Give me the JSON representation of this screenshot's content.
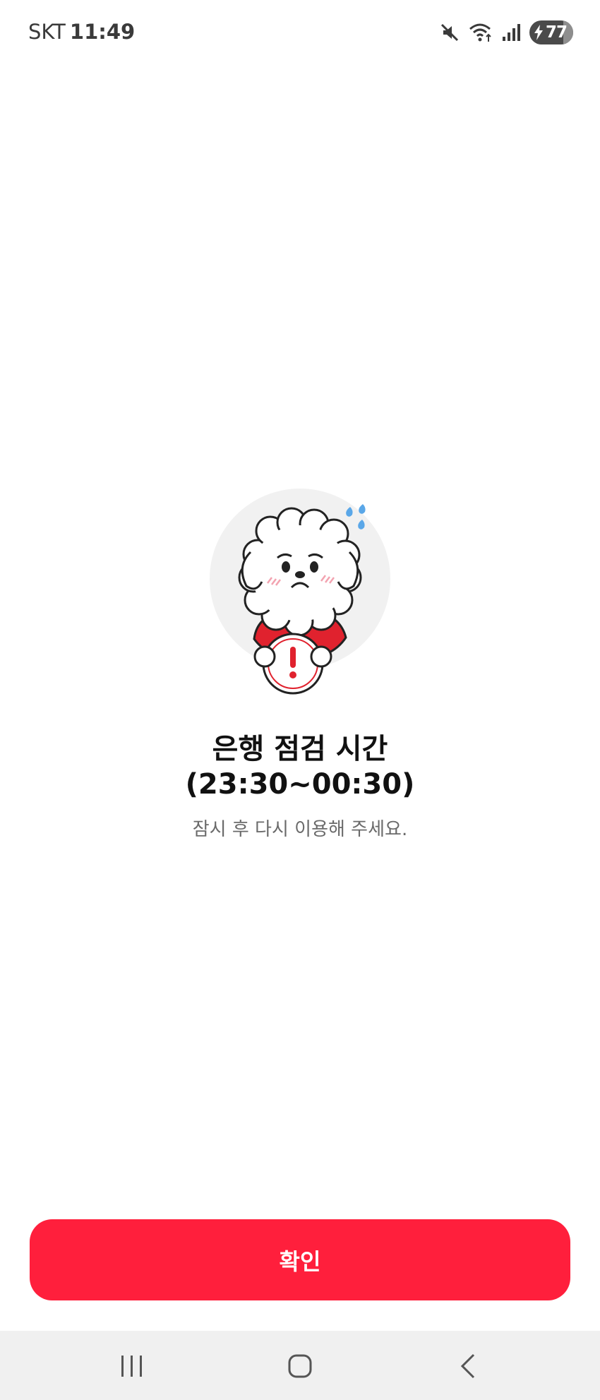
{
  "status_bar": {
    "carrier": "SKT",
    "time": "11:49",
    "battery_level": "77",
    "battery_fraction": 0.77,
    "icons": [
      "mute-icon",
      "wifi-icon",
      "signal-icon",
      "battery-charging-icon"
    ]
  },
  "illustration": {
    "name": "worried-bichon-mascot",
    "description_icons": [
      "sweat-drops-icon",
      "exclamation-sign-icon"
    ]
  },
  "message": {
    "title_line1": "은행 점검 시간",
    "title_line2": "(23:30~00:30)",
    "subtitle": "잠시 후 다시 이용해 주세요."
  },
  "confirm_button": {
    "label": "확인"
  },
  "nav_bar": {
    "items": [
      "recent-apps",
      "home",
      "back"
    ]
  },
  "colors": {
    "accent": "#ff1f3c",
    "title": "#111111",
    "subtitle": "#6a6a6a",
    "nav_bg": "#f0f0f0"
  }
}
